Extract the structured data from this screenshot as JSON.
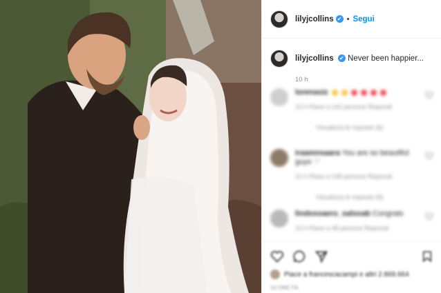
{
  "header": {
    "username": "lilyjcollins",
    "separator": "•",
    "follow_label": "Segui",
    "verified_glyph": "✔"
  },
  "caption": {
    "username": "lilyjcollins",
    "text": "Never been happier...",
    "time": "10 h"
  },
  "comments": [
    {
      "username": "lorenasiz",
      "text": "",
      "meta": "10 h  Piace a 142 persone  Rispondi",
      "more": "Visualizza le risposte (6)",
      "emoji_colors": [
        "#f6c344",
        "#f6c344",
        "#ed4956",
        "#ed4956",
        "#ed4956",
        "#ed4956"
      ]
    },
    {
      "username": "iraamnsaara",
      "text": "You are so beautiful guys ♡",
      "meta": "10 h  Piace a 148 persone  Rispondi",
      "more": "Visualizza le risposte (9)"
    },
    {
      "username": "lindossaero_salsoab",
      "text": "Congrats",
      "meta": "10 h  Piace a 48 persone  Rispondi",
      "more": ""
    }
  ],
  "actions": {
    "likes_text": "Piace a francescacampi e altri 2.869.664",
    "date": "10 ore fa"
  },
  "icons": [
    "heart-icon",
    "comment-icon",
    "share-icon",
    "bookmark-icon"
  ],
  "colors": {
    "accent": "#0095f6",
    "verified": "#3897f0",
    "muted": "#8e8e8e",
    "text": "#262626"
  }
}
